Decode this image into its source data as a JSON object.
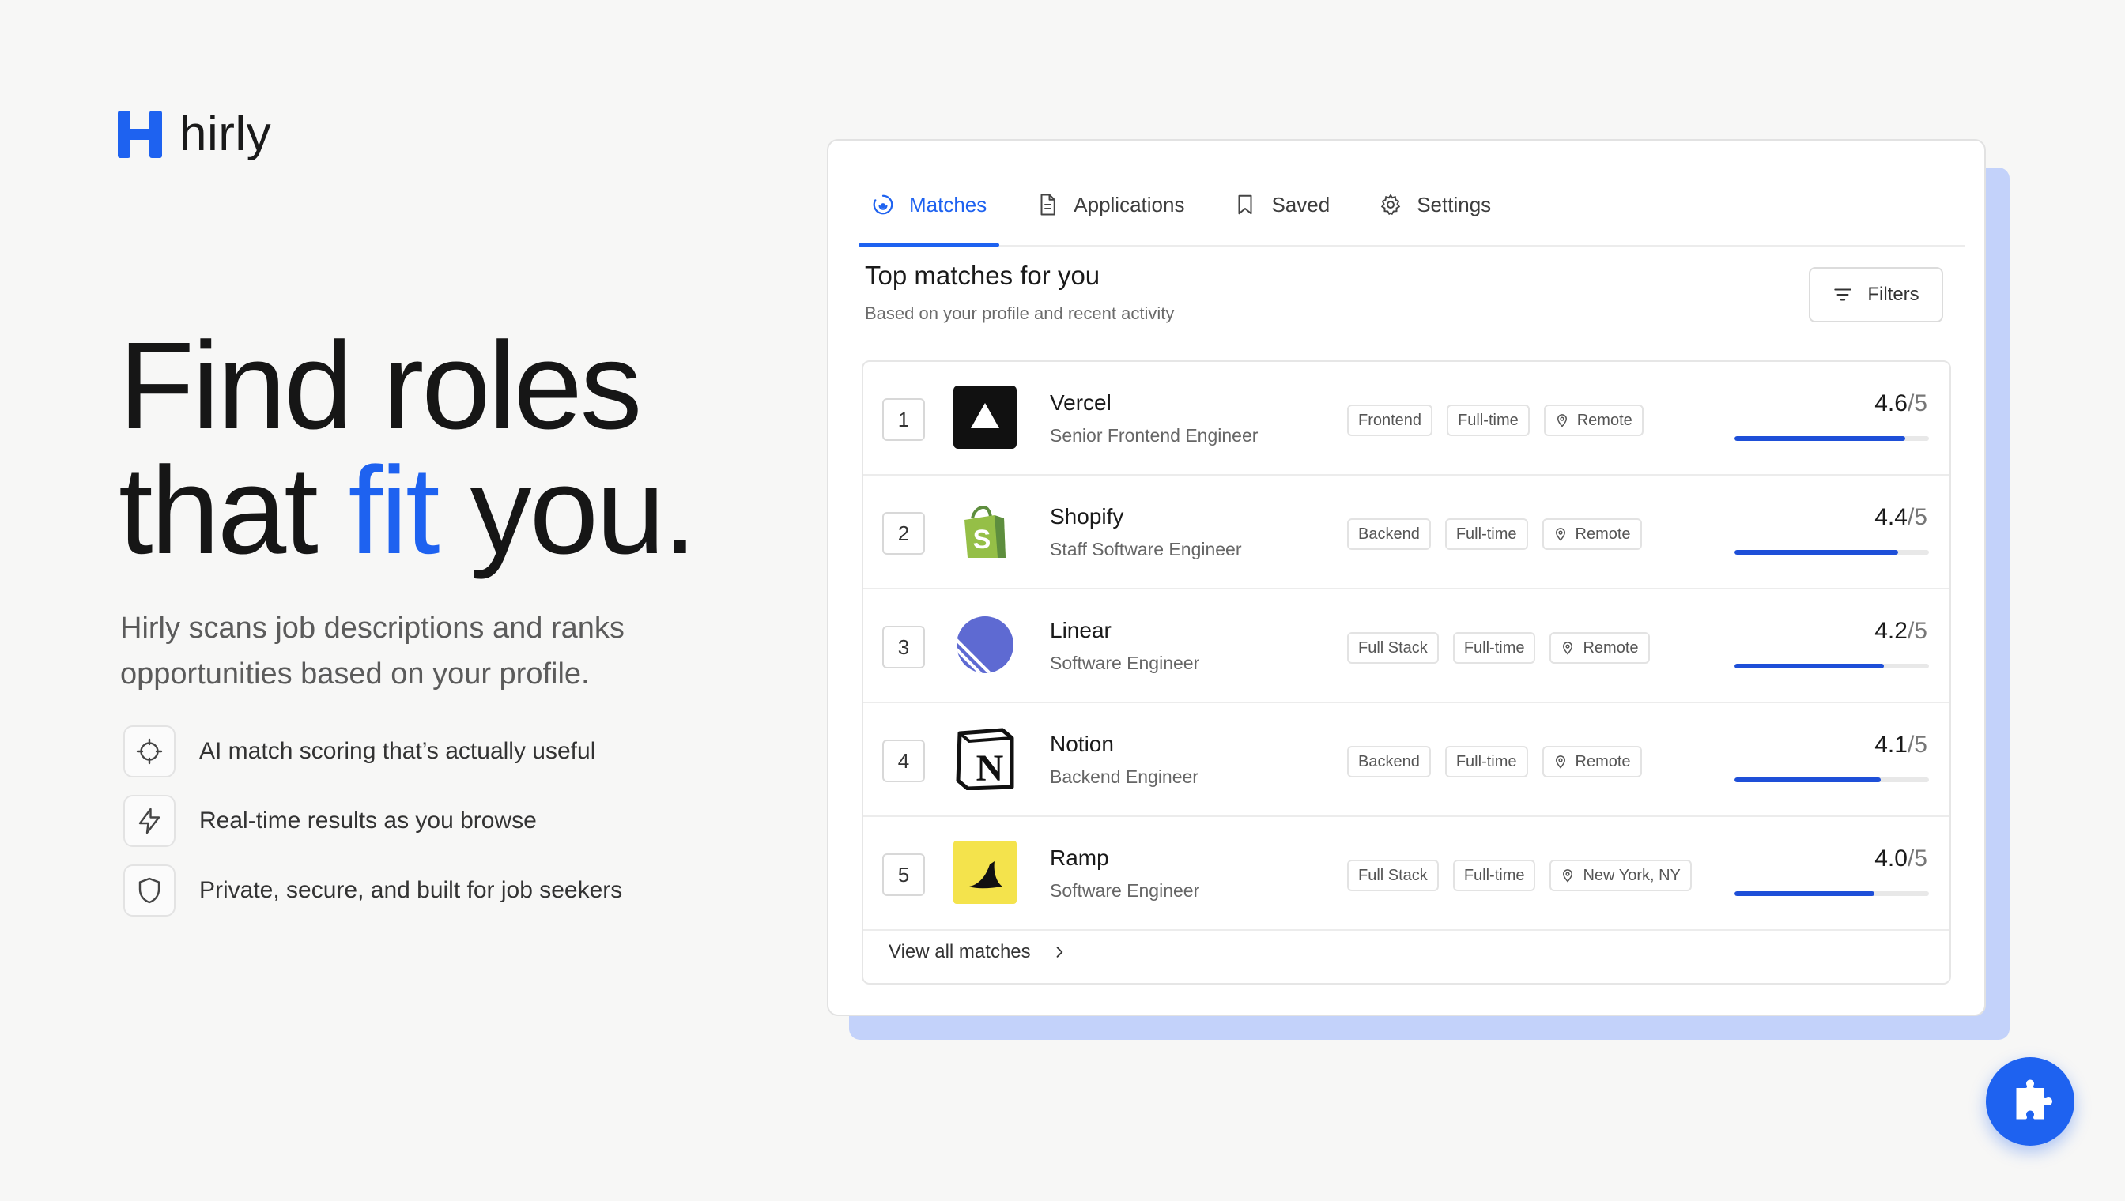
{
  "brand": {
    "name": "hirly",
    "accent": "#1e62f0",
    "logo_icon": "h-logo-icon"
  },
  "hero": {
    "line1": "Find roles",
    "line2_pre": "that ",
    "line2_accent": "fit",
    "line2_post": " you."
  },
  "subtitle": "Hirly scans job descriptions and ranks opportunities based on your profile.",
  "features": [
    {
      "icon": "crosshair-icon",
      "text": "AI match scoring that’s actually useful"
    },
    {
      "icon": "lightning-icon",
      "text": "Real-time results as you browse"
    },
    {
      "icon": "shield-icon",
      "text": "Private, secure, and built for job seekers"
    }
  ],
  "tabs": [
    {
      "label": "Matches",
      "icon": "matches-icon",
      "active": true
    },
    {
      "label": "Applications",
      "icon": "document-icon",
      "active": false
    },
    {
      "label": "Saved",
      "icon": "bookmark-icon",
      "active": false
    },
    {
      "label": "Settings",
      "icon": "gear-icon",
      "active": false
    }
  ],
  "section": {
    "title": "Top matches for you",
    "subtitle": "Based on your profile and recent activity",
    "filters_label": "Filters"
  },
  "matches": [
    {
      "rank": "1",
      "company": "Vercel",
      "title": "Senior Frontend Engineer",
      "tags": [
        "Frontend",
        "Full-time"
      ],
      "location": "Remote",
      "score": "4.6",
      "denom": "/5",
      "fill": 0.88,
      "logo": "vercel-logo"
    },
    {
      "rank": "2",
      "company": "Shopify",
      "title": "Staff Software Engineer",
      "tags": [
        "Backend",
        "Full-time"
      ],
      "location": "Remote",
      "score": "4.4",
      "denom": "/5",
      "fill": 0.84,
      "logo": "shopify-logo"
    },
    {
      "rank": "3",
      "company": "Linear",
      "title": "Software Engineer",
      "tags": [
        "Full Stack",
        "Full-time"
      ],
      "location": "Remote",
      "score": "4.2",
      "denom": "/5",
      "fill": 0.77,
      "logo": "linear-logo"
    },
    {
      "rank": "4",
      "company": "Notion",
      "title": "Backend Engineer",
      "tags": [
        "Backend",
        "Full-time"
      ],
      "location": "Remote",
      "score": "4.1",
      "denom": "/5",
      "fill": 0.75,
      "logo": "notion-logo"
    },
    {
      "rank": "5",
      "company": "Ramp",
      "title": "Software Engineer",
      "tags": [
        "Full Stack",
        "Full-time"
      ],
      "location": "New York, NY",
      "score": "4.0",
      "denom": "/5",
      "fill": 0.72,
      "logo": "ramp-logo"
    }
  ],
  "view_all_label": "View all matches",
  "fab_icon": "puzzle-icon"
}
